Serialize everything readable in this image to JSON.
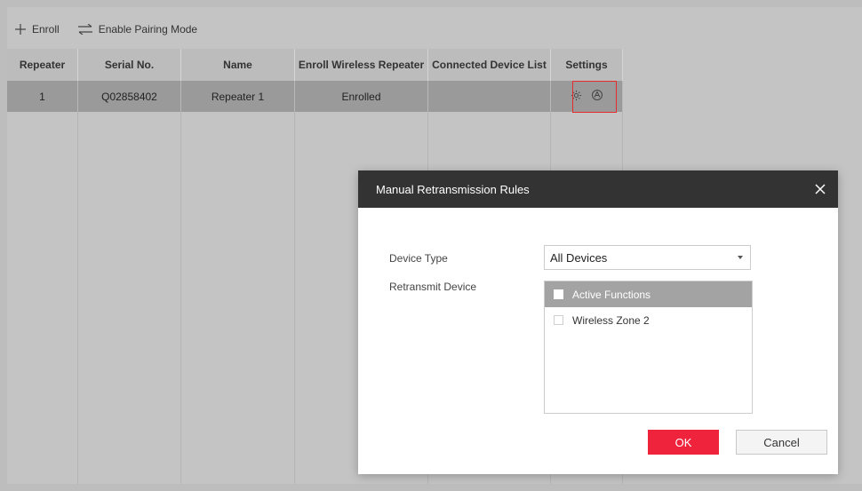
{
  "toolbar": {
    "enroll_label": "Enroll",
    "pairing_label": "Enable Pairing Mode"
  },
  "table": {
    "headers": [
      "Repeater",
      "Serial No.",
      "Name",
      "Enroll Wireless Repeater",
      "Connected Device List",
      "Settings"
    ],
    "rows": [
      {
        "repeater": "1",
        "serial": "Q02858402",
        "name": "Repeater 1",
        "enroll_status": "Enrolled",
        "connected": "",
        "settings_icons": [
          "gear-icon",
          "retransmission-icon"
        ]
      }
    ]
  },
  "modal": {
    "title": "Manual Retransmission Rules",
    "device_type_label": "Device Type",
    "device_type_value": "All Devices",
    "retransmit_label": "Retransmit Device",
    "devices": [
      {
        "label": "Active Functions",
        "selected": true
      },
      {
        "label": "Wireless Zone 2",
        "selected": false
      }
    ],
    "ok_label": "OK",
    "cancel_label": "Cancel"
  },
  "colors": {
    "accent": "#ef233c",
    "highlight": "#e52b2b",
    "modal_header": "#333333"
  }
}
